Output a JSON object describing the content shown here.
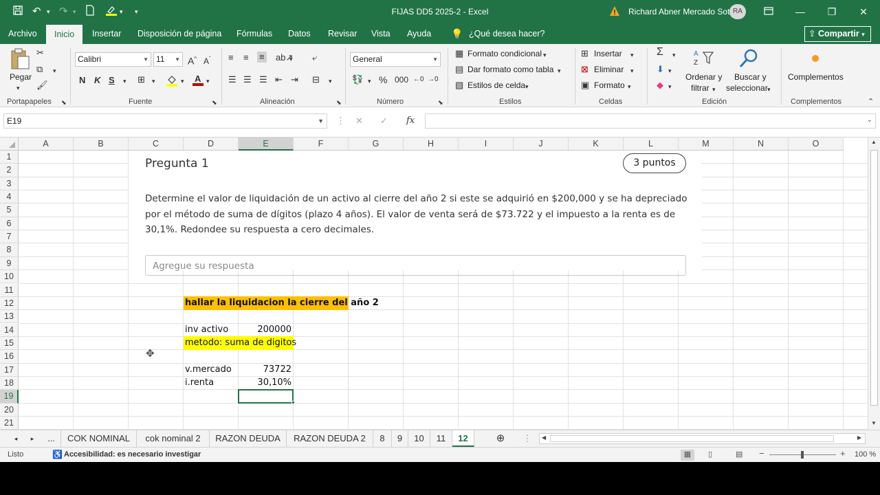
{
  "window": {
    "title": "FIJAS DD5 2025-2  -  Excel",
    "user": "Richard Abner Mercado Soto",
    "avatar": "RA"
  },
  "menu": {
    "tabs": [
      "Archivo",
      "Inicio",
      "Insertar",
      "Disposición de página",
      "Fórmulas",
      "Datos",
      "Revisar",
      "Vista",
      "Ayuda"
    ],
    "tell_me": "¿Qué desea hacer?",
    "share": "Compartir"
  },
  "ribbon": {
    "paste": "Pegar",
    "font_name": "Calibri",
    "font_size": "11",
    "number_format": "General",
    "cond_format": "Formato condicional",
    "format_table": "Dar formato como tabla",
    "cell_styles": "Estilos de celda",
    "insert": "Insertar",
    "delete": "Eliminar",
    "format": "Formato",
    "sort_filter_1": "Ordenar y",
    "sort_filter_2": "filtrar",
    "find_select_1": "Buscar y",
    "find_select_2": "seleccionar",
    "addins": "Complementos",
    "groups": {
      "clipboard": "Portapapeles",
      "font": "Fuente",
      "alignment": "Alineación",
      "number": "Número",
      "styles": "Estilos",
      "cells": "Celdas",
      "editing": "Edición",
      "addins": "Complementos"
    }
  },
  "formula_bar": {
    "name_box": "E19",
    "fx": "fx",
    "content": ""
  },
  "columns": [
    "A",
    "B",
    "C",
    "D",
    "E",
    "F",
    "G",
    "H",
    "I",
    "J",
    "K",
    "L",
    "M",
    "N",
    "O"
  ],
  "rows": [
    "1",
    "2",
    "3",
    "4",
    "5",
    "6",
    "7",
    "8",
    "9",
    "10",
    "11",
    "12",
    "13",
    "14",
    "15",
    "16",
    "17",
    "18",
    "19",
    "20",
    "21"
  ],
  "question": {
    "title": "Pregunta 1",
    "points": "3 puntos",
    "body": "Determine el valor de liquidación de un activo al cierre del año 2 si este se adquirió en $200,000 y se ha depreciado por el método de suma de dígitos (plazo 4 años). El valor de venta será de $73.722 y el impuesto a la renta es de 30,1%. Redondee su respuesta a cero decimales.",
    "answer_placeholder": "Agregue su respuesta"
  },
  "cells": {
    "d12": "hallar la liquidacion la cierre del año 2",
    "d14": "inv activo",
    "e14": "200000",
    "d15": "metodo: suma de digitos",
    "d17": "v.mercado",
    "e17": "73722",
    "d18": "i.renta",
    "e18": "30,10%"
  },
  "sheets": [
    "...",
    "COK NOMINAL",
    "cok nominal 2",
    "RAZON DEUDA",
    "RAZON DEUDA 2",
    "8",
    "9",
    "10",
    "11",
    "12"
  ],
  "active_sheet": "12",
  "status": {
    "ready": "Listo",
    "accessibility": "Accesibilidad: es necesario investigar",
    "zoom": "100 %"
  },
  "colors": {
    "excel_green": "#217346",
    "highlight_orange": "#ffc000",
    "highlight_yellow": "#ffff00"
  }
}
